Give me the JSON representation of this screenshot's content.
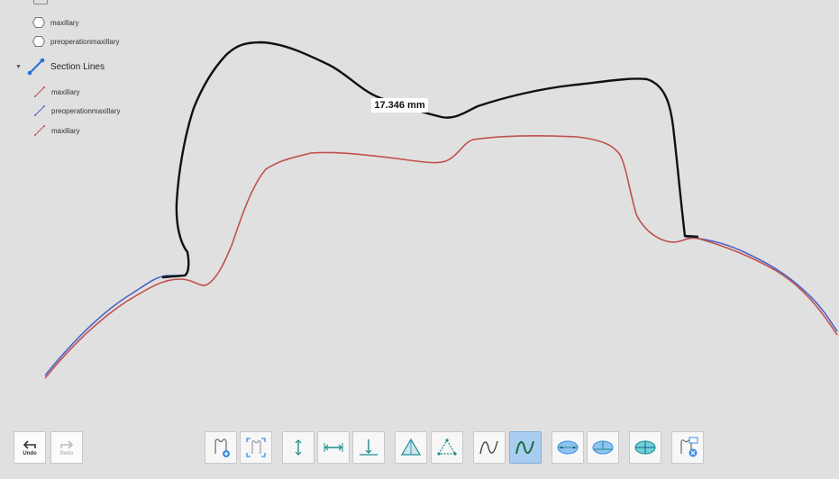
{
  "tree": {
    "items_top": [
      {
        "label": "maxillary",
        "icon": "hexagon-outline-icon"
      },
      {
        "label": "preoperationmaxillary",
        "icon": "hexagon-outline-icon"
      }
    ],
    "section_group": {
      "label": "Section Lines",
      "icon": "section-line-icon"
    },
    "section_items": [
      {
        "label": "maxillary",
        "color": "#c0504d"
      },
      {
        "label": "preoperationmaxillary",
        "color": "#4a63c8"
      },
      {
        "label": "maxillary",
        "color": "#c0504d"
      }
    ]
  },
  "measurement": {
    "value": "17.346 mm"
  },
  "undo": {
    "label": "Undo"
  },
  "redo": {
    "label": "Redo"
  },
  "colors": {
    "black_curve": "#111111",
    "red_curve": "#c0504d",
    "blue_curve": "#4a63c8",
    "active_tool": "#a8cdf0",
    "tool_teal": "#1a8c8c",
    "tool_blue": "#3a8ee6"
  }
}
